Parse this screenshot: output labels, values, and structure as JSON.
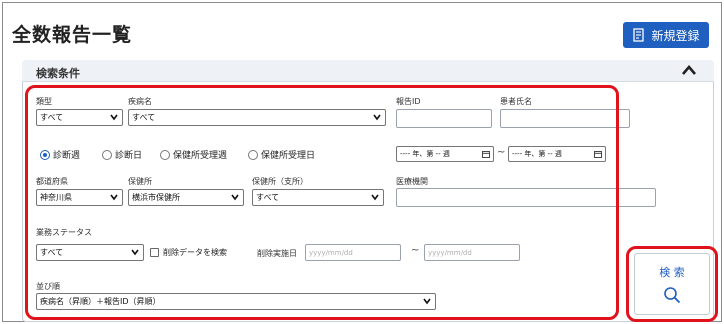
{
  "page": {
    "title": "全数報告一覧"
  },
  "toolbar": {
    "new_label": "新規登録"
  },
  "search_panel": {
    "title": "検索条件",
    "type": {
      "label": "類型",
      "value": "すべて"
    },
    "disease": {
      "label": "疾病名",
      "value": "すべて"
    },
    "report_id": {
      "label": "報告ID",
      "value": ""
    },
    "patient_name": {
      "label": "患者氏名",
      "value": ""
    },
    "date_mode": {
      "options": [
        "診断週",
        "診断日",
        "保健所受理週",
        "保健所受理日"
      ],
      "selected": "診断週"
    },
    "week_from": "---- 年、第 -- 週",
    "week_to": "---- 年、第 -- 週",
    "week_sep": "~",
    "prefecture": {
      "label": "都道府県",
      "value": "神奈川県"
    },
    "health_center": {
      "label": "保健所",
      "value": "横浜市保健所"
    },
    "branch": {
      "label": "保健所（支所）",
      "value": "すべて"
    },
    "medical_institution": {
      "label": "医療機関",
      "value": ""
    },
    "business_status": {
      "label": "業務ステータス",
      "value": "すべて"
    },
    "include_deleted": {
      "label": "削除データを検索",
      "checked": false
    },
    "delete_date": {
      "label": "削除実施日",
      "placeholder_from": "yyyy/mm/dd",
      "placeholder_to": "yyyy/mm/dd",
      "sep": "~"
    },
    "sort": {
      "label": "並び順",
      "value": "疾病名（昇順）＋報告ID（昇順）"
    }
  },
  "search_button": {
    "label": "検 索"
  },
  "colors": {
    "accent": "#1f5fbf",
    "highlight": "#e0121b"
  }
}
